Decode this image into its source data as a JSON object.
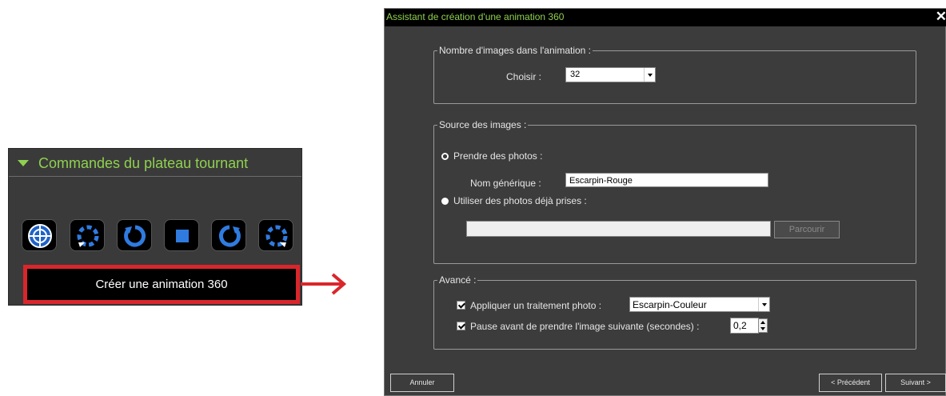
{
  "panel": {
    "title": "Commandes du plateau tournant",
    "accent_color": "#8fd14f",
    "highlight_color": "#d9262c",
    "tool_icons": [
      "crosshair-target-icon",
      "rotate-left-dashed-icon",
      "rotate-ccw-icon",
      "stop-square-icon",
      "rotate-cw-icon",
      "rotate-right-dashed-icon"
    ],
    "create_label": "Créer une animation 360"
  },
  "dialog": {
    "title": "Assistant de création d'une animation 360",
    "close_label": "✕",
    "images_group": {
      "legend": "Nombre d'images dans l'animation :",
      "choose_label": "Choisir :",
      "choose_value": "32"
    },
    "source_group": {
      "legend": "Source des images :",
      "take_photos_label": "Prendre des photos :",
      "take_photos_selected": true,
      "generic_name_label": "Nom générique :",
      "generic_name_value": "Escarpin-Rouge",
      "use_existing_label": "Utiliser des photos déjà prises :",
      "path_value": "",
      "browse_label": "Parcourir"
    },
    "advanced_group": {
      "legend": "Avancé :",
      "apply_processing_label": "Appliquer un traitement photo :",
      "apply_processing_checked": true,
      "processing_value": "Escarpin-Couleur",
      "pause_label": "Pause avant de prendre l'image suivante (secondes) :",
      "pause_checked": true,
      "pause_value": "0,2"
    },
    "footer": {
      "cancel_label": "Annuler",
      "previous_label": "< Précédent",
      "next_label": "Suivant >"
    }
  }
}
